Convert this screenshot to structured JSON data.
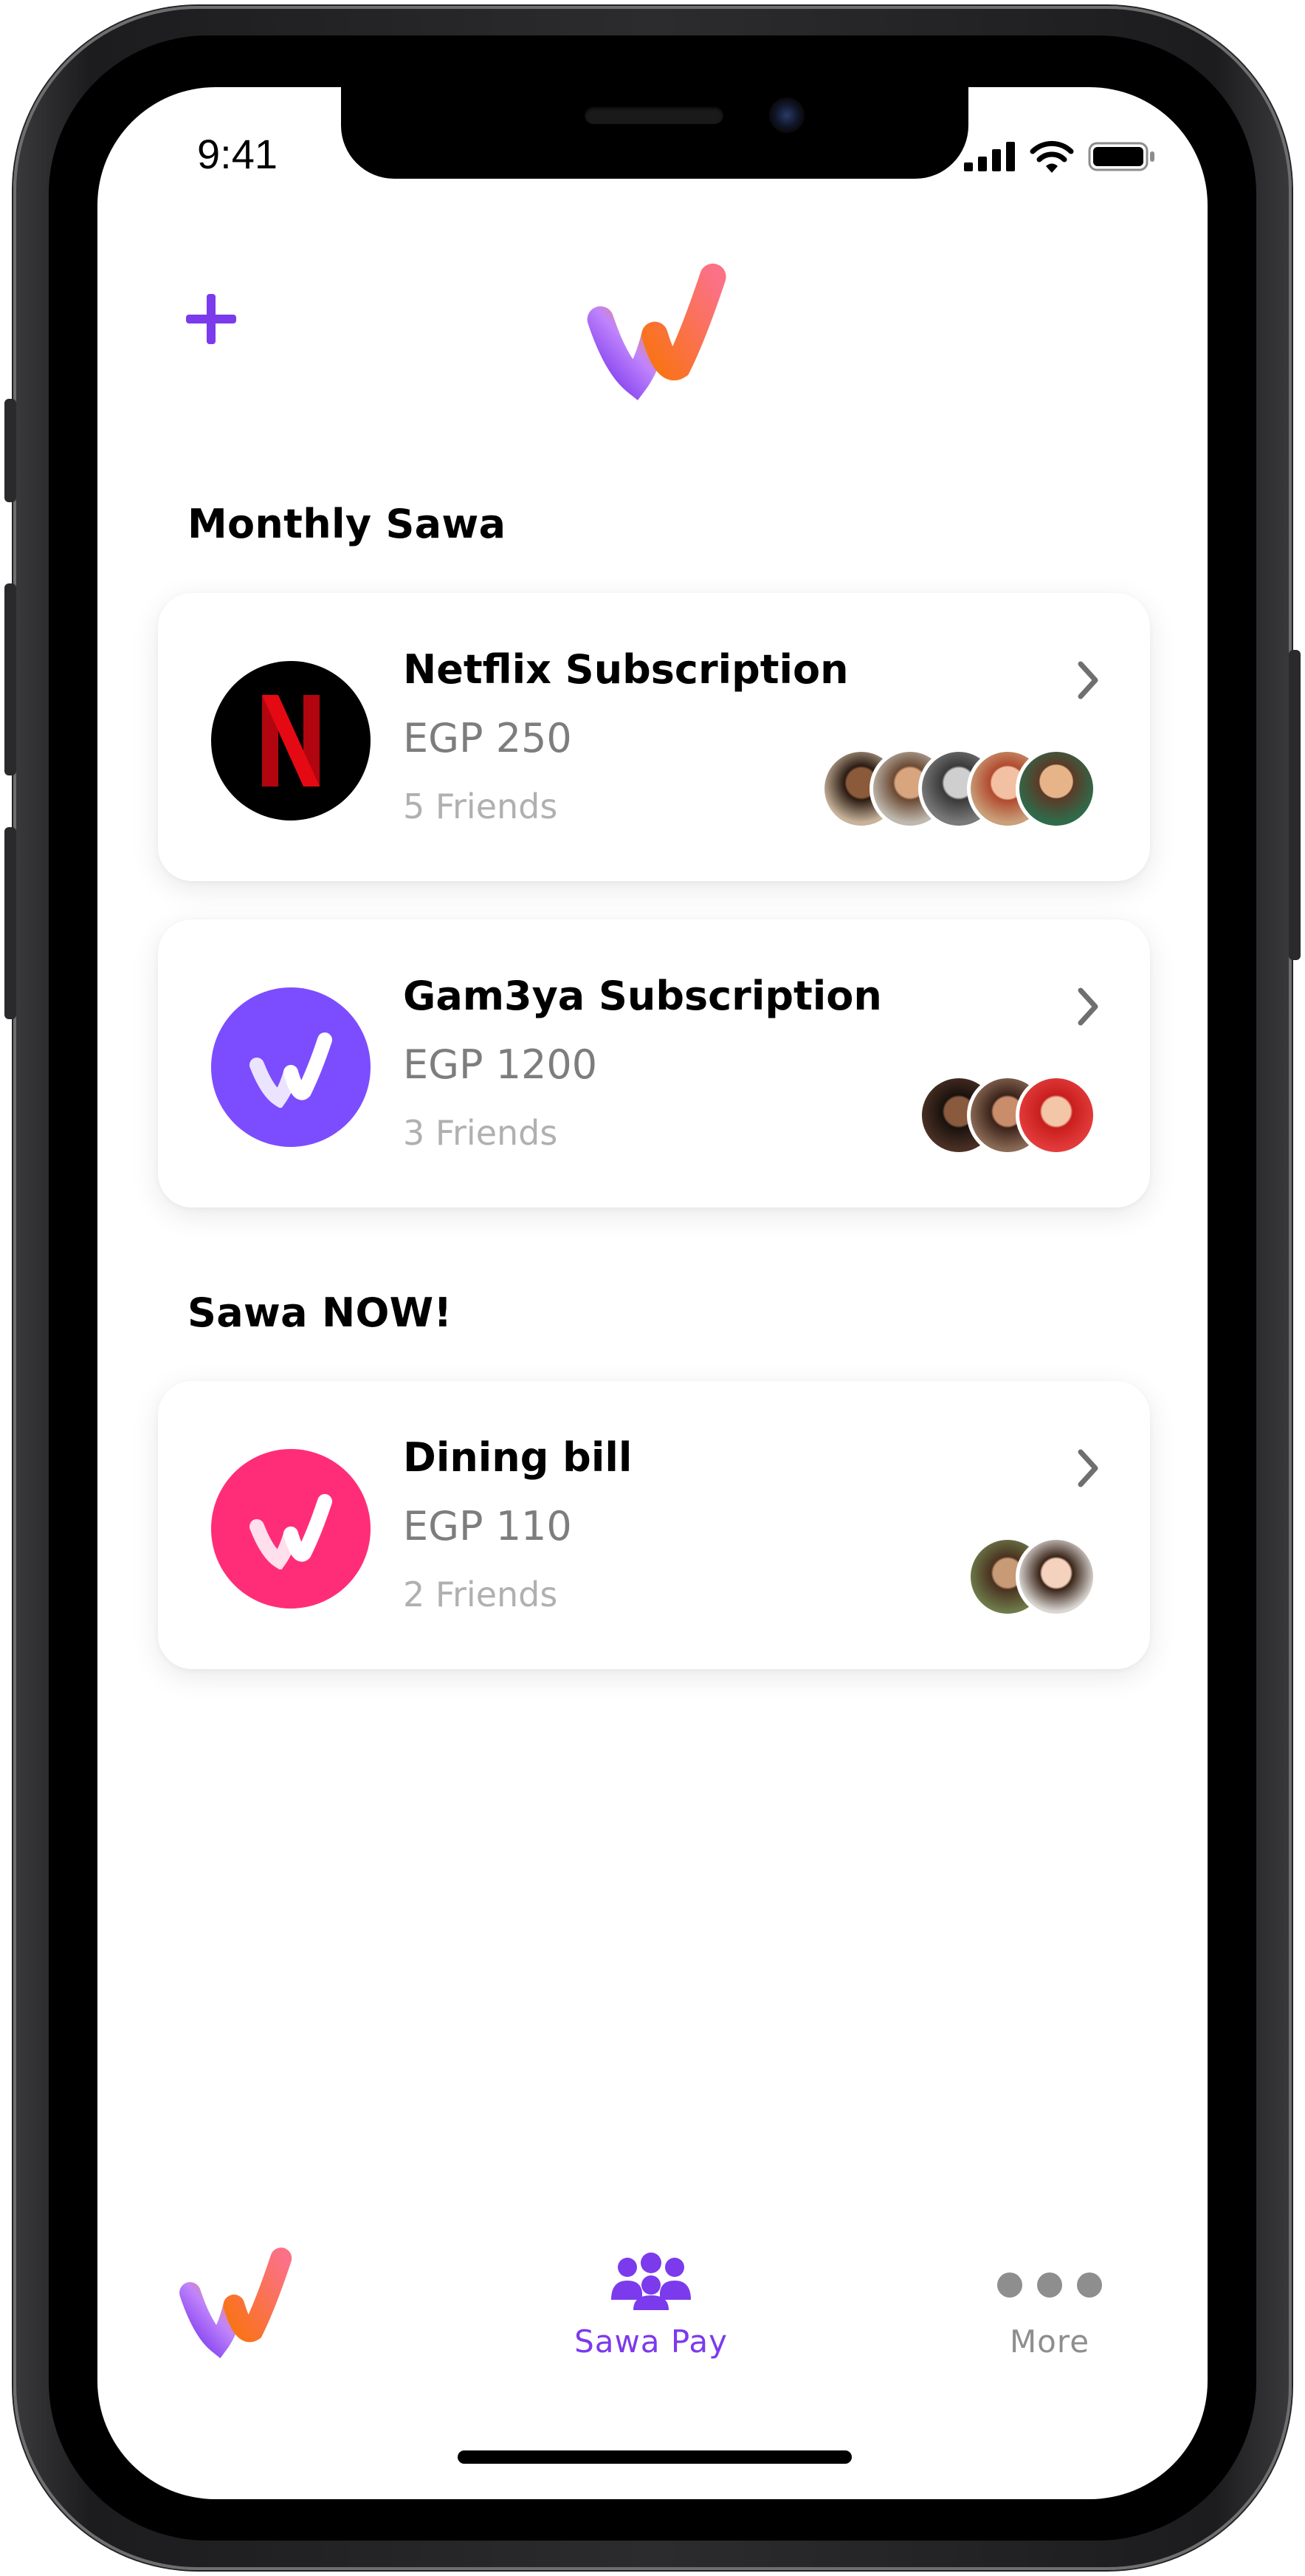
{
  "status_bar": {
    "time": "9:41"
  },
  "header": {
    "add_icon": "plus-icon",
    "logo_icon": "sawa-logo-icon"
  },
  "sections": [
    {
      "title": "Monthly Sawa"
    },
    {
      "title": "Sawa NOW!"
    }
  ],
  "cards": [
    {
      "title": "Netflix Subscription",
      "amount": "EGP 250",
      "friends": "5 Friends",
      "icon": "netflix-icon",
      "icon_bg": "#000000",
      "avatar_count": 5
    },
    {
      "title": "Gam3ya Subscription",
      "amount": "EGP 1200",
      "friends": "3 Friends",
      "icon": "sawa-check-icon",
      "icon_bg": "#7c4dff",
      "avatar_count": 3
    },
    {
      "title": "Dining bill",
      "amount": "EGP 110",
      "friends": "2 Friends",
      "icon": "sawa-check-icon",
      "icon_bg": "#ff2d78",
      "avatar_count": 2
    }
  ],
  "tabbar": {
    "home_icon": "sawa-logo-icon",
    "sawa_pay": {
      "label": "Sawa Pay",
      "icon": "group-icon",
      "color": "#7c3aed"
    },
    "more": {
      "label": "More",
      "icon": "more-dots-icon",
      "color": "#8e8e8e"
    }
  },
  "colors": {
    "accent": "#7c3aed",
    "logo_purple": "#8b5cf6",
    "logo_orange": "#fb923c"
  }
}
